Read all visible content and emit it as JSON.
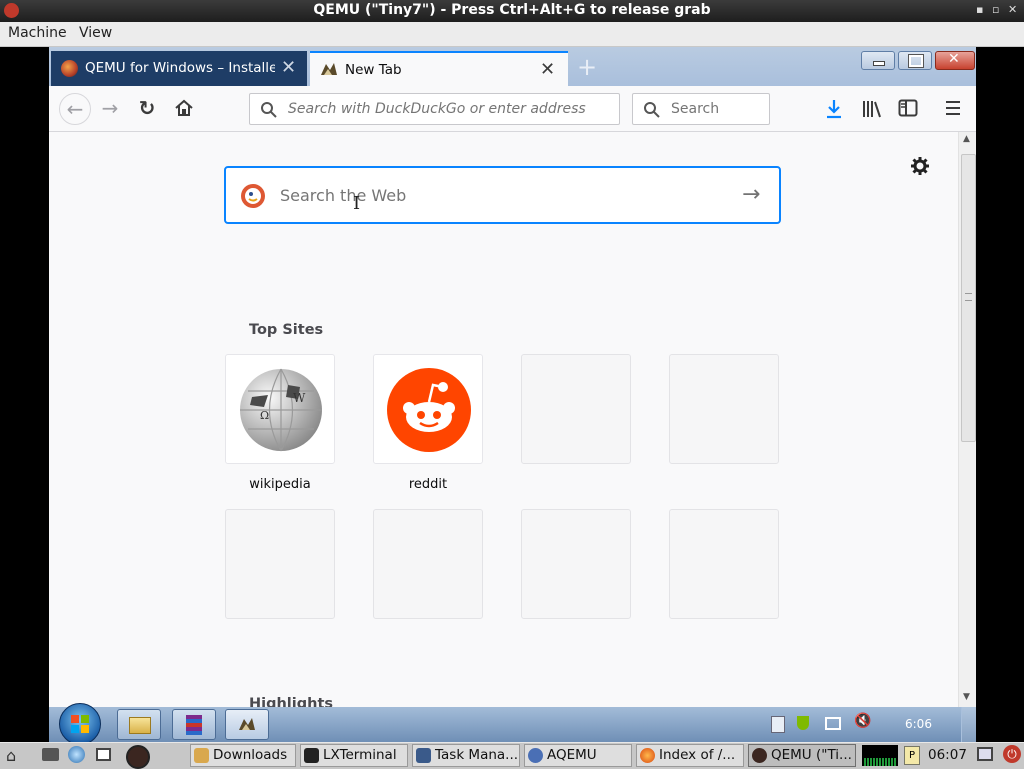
{
  "host_window": {
    "title": "QEMU (\"Tiny7\") - Press Ctrl+Alt+G to release grab",
    "controls": [
      "▪",
      "▫",
      "✕"
    ],
    "menu": [
      "Machine",
      "View"
    ]
  },
  "browser": {
    "tabs": [
      {
        "label": "QEMU for Windows – Installers",
        "icon": "qemu-logo-icon",
        "active": false
      },
      {
        "label": "New Tab",
        "icon": "firefox-newtab-icon",
        "active": true
      }
    ],
    "new_tab_symbol": "+",
    "url_placeholder": "Search with DuckDuckGo or enter address",
    "search_placeholder": "Search",
    "new_tab_page": {
      "search_placeholder": "Search the Web",
      "top_sites_heading": "Top Sites",
      "top_sites": [
        {
          "label": "wikipedia",
          "icon": "wikipedia-globe-icon"
        },
        {
          "label": "reddit",
          "icon": "reddit-alien-icon"
        },
        {
          "label": "",
          "icon": ""
        },
        {
          "label": "",
          "icon": ""
        },
        {
          "label": "",
          "icon": ""
        },
        {
          "label": "",
          "icon": ""
        },
        {
          "label": "",
          "icon": ""
        },
        {
          "label": "",
          "icon": ""
        }
      ],
      "highlights_heading": "Highlights"
    }
  },
  "guest_taskbar": {
    "clock": "6:06",
    "pinned": [
      "windows-explorer-icon",
      "winrar-icon",
      "firefox-icon"
    ]
  },
  "host_taskbar": {
    "items": [
      {
        "label": "Downloads",
        "icon": "folder-icon"
      },
      {
        "label": "LXTerminal",
        "icon": "terminal-icon"
      },
      {
        "label": "Task Mana...",
        "icon": "task-manager-icon"
      },
      {
        "label": "AQEMU",
        "icon": "aqemu-icon"
      },
      {
        "label": "Index of /...",
        "icon": "firefox-icon"
      },
      {
        "label": "QEMU (\"Ti...",
        "icon": "qemu-icon"
      }
    ],
    "clock": "06:07"
  },
  "colors": {
    "accent": "#0a84ff",
    "reddit": "#ff4500",
    "active_tab_dark": "#1e3d66"
  }
}
